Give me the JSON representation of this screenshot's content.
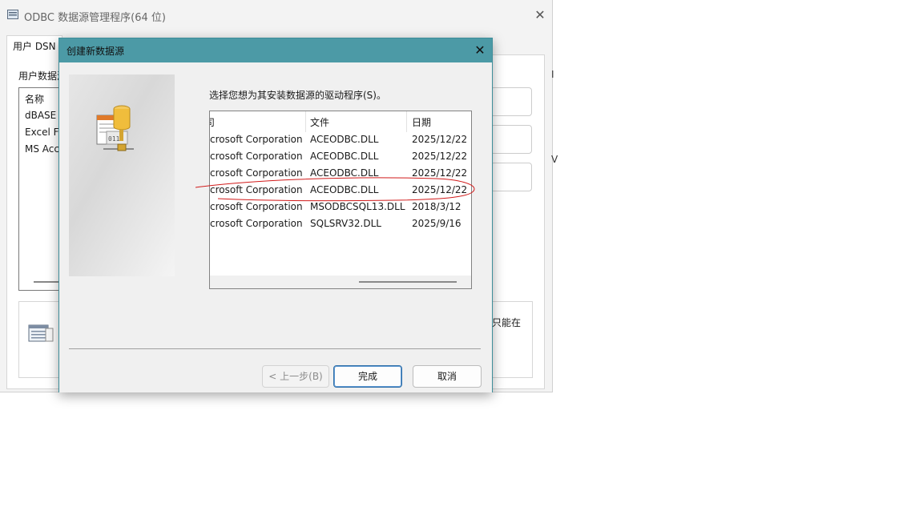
{
  "background_window": {
    "title": "ODBC 数据源管理程序(64 位)",
    "close_label": "✕",
    "tab_label": "用户 DSN",
    "section_label": "用户数据源",
    "list_header": "名称",
    "list_items": [
      "dBASE",
      "Excel Fi",
      "MS Acc"
    ],
    "info_text": "只能在",
    "edge_text_1": "I",
    "edge_text_2": "V"
  },
  "dialog": {
    "title": "创建新数据源",
    "close_label": "✕",
    "prompt": "选择您想为其安装数据源的驱动程序(S)。",
    "columns": [
      "司",
      "文件",
      "日期"
    ],
    "rows": [
      {
        "company": "crosoft Corporation",
        "file": "ACEODBC.DLL",
        "date": "2025/12/22"
      },
      {
        "company": "crosoft Corporation",
        "file": "ACEODBC.DLL",
        "date": "2025/12/22"
      },
      {
        "company": "crosoft Corporation",
        "file": "ACEODBC.DLL",
        "date": "2025/12/22"
      },
      {
        "company": "crosoft Corporation",
        "file": "ACEODBC.DLL",
        "date": "2025/12/22"
      },
      {
        "company": "crosoft Corporation",
        "file": "MSODBCSQL13.DLL",
        "date": "2018/3/12"
      },
      {
        "company": "crosoft Corporation",
        "file": "SQLSRV32.DLL",
        "date": "2025/9/16"
      }
    ],
    "buttons": {
      "back": "< 上一步(B)",
      "finish": "完成",
      "cancel": "取消"
    },
    "annotation_color": "#d11a1a"
  }
}
